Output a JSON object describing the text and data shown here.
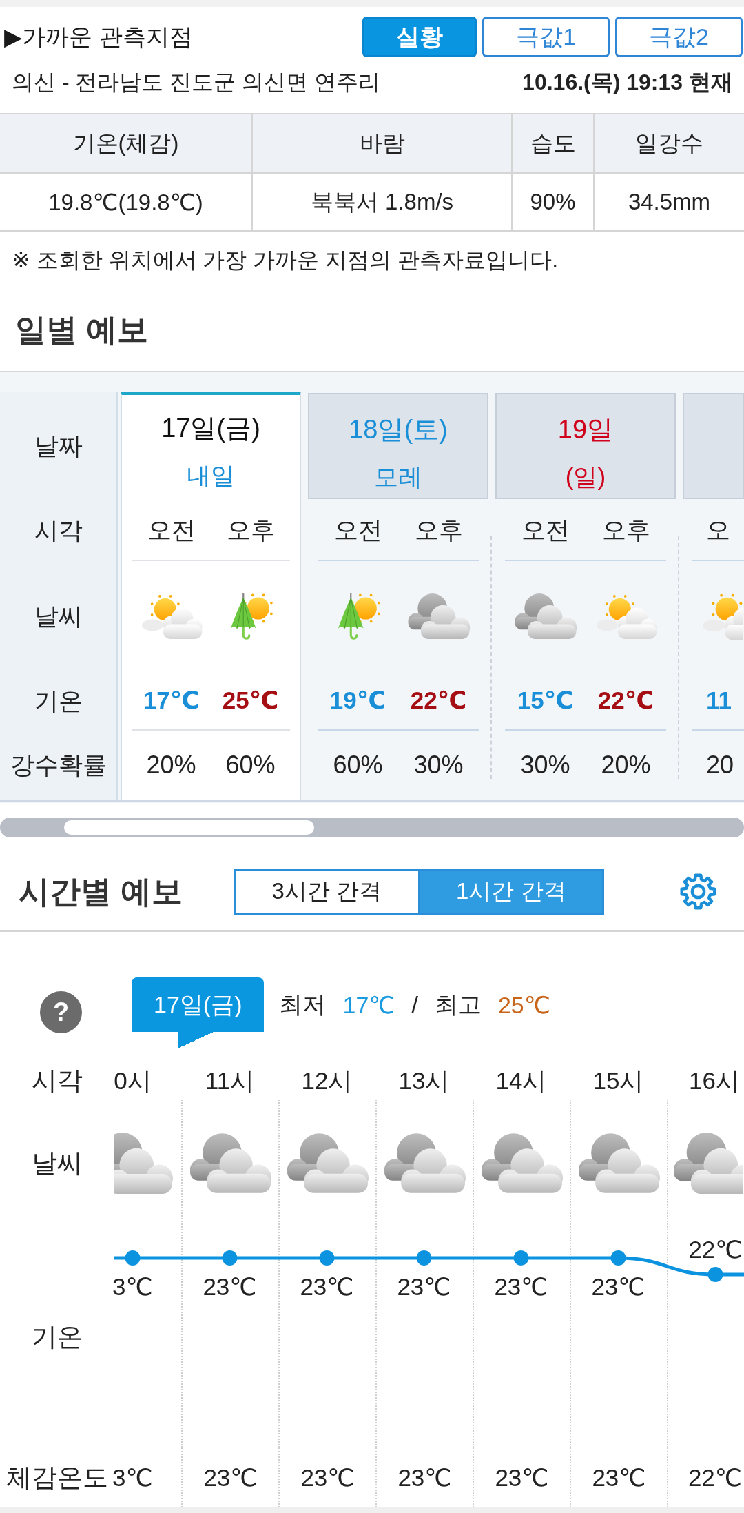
{
  "station": {
    "title": "▶가까운 관측지점",
    "modes": [
      {
        "label": "실황",
        "selected": true
      },
      {
        "label": "극값1",
        "selected": false
      },
      {
        "label": "극값2",
        "selected": false
      }
    ],
    "location": "의신 - 전라남도 진도군 의신면 연주리",
    "observed_at": "10.16.(목) 19:13 현재"
  },
  "observation_table": {
    "columns": [
      "기온(체감)",
      "바람",
      "습도",
      "일강수"
    ],
    "values": [
      "19.8℃(19.8℃)",
      "북북서 1.8m/s",
      "90%",
      "34.5mm"
    ]
  },
  "note": "※ 조회한 위치에서 가장 가까운 지점의 관측자료입니다.",
  "daily_forecast": {
    "title": "일별 예보",
    "row_labels": [
      "날짜",
      "시각",
      "날씨",
      "기온",
      "강수확률"
    ],
    "days": [
      {
        "date": "17일(금)",
        "color": "#111111",
        "note": {
          "text": "내일",
          "color": "#1a8fd8"
        },
        "selected": true,
        "periods": [
          {
            "time": "오전",
            "kind": "partly_cloudy",
            "temp": {
              "text": "17℃",
              "color": "#1a8fd8"
            },
            "pop": "20%"
          },
          {
            "time": "오후",
            "kind": "rain",
            "temp": {
              "text": "25℃",
              "color": "#a50f14"
            },
            "pop": "60%"
          }
        ]
      },
      {
        "date": "18일(토)",
        "color": "#1a8fd8",
        "note": {
          "text": "모레",
          "color": "#1a8fd8"
        },
        "selected": false,
        "periods": [
          {
            "time": "오전",
            "kind": "rain",
            "temp": {
              "text": "19℃",
              "color": "#1a8fd8"
            },
            "pop": "60%"
          },
          {
            "time": "오후",
            "kind": "cloudy",
            "temp": {
              "text": "22℃",
              "color": "#a50f14"
            },
            "pop": "30%"
          }
        ]
      },
      {
        "date": "19일",
        "color": "#d0021b",
        "note": {
          "text": "(일)",
          "color": "#d0021b"
        },
        "selected": false,
        "periods": [
          {
            "time": "오전",
            "kind": "cloudy",
            "temp": {
              "text": "15℃",
              "color": "#1a8fd8"
            },
            "pop": "30%"
          },
          {
            "time": "오후",
            "kind": "partly_cloudy",
            "temp": {
              "text": "22℃",
              "color": "#a50f14"
            },
            "pop": "20%"
          }
        ]
      },
      {
        "selected": false,
        "periods": [
          {
            "time": "오",
            "kind": "partly_cloudy",
            "temp": {
              "text": "11",
              "color": "#1a8fd8"
            },
            "pop": "20"
          }
        ]
      }
    ]
  },
  "hourly_forecast": {
    "title": "시간별 예보",
    "intervals": [
      {
        "label": "3시간 간격",
        "selected": false
      },
      {
        "label": "1시간 간격",
        "selected": true
      }
    ],
    "help": "?",
    "date": "17일(금)",
    "min_label": "최저",
    "min": "17℃",
    "separator": "/",
    "max_label": "최고",
    "max": "25℃",
    "row_labels": [
      "시각",
      "날씨",
      "기온",
      "체감온도"
    ],
    "hours": [
      {
        "kind": "cloudy",
        "feels": "3℃"
      },
      {
        "kind": "cloudy",
        "feels": "23℃"
      },
      {
        "kind": "cloudy",
        "feels": "23℃"
      },
      {
        "kind": "cloudy",
        "feels": "23℃"
      },
      {
        "kind": "cloudy",
        "feels": "23℃"
      },
      {
        "kind": "cloudy",
        "feels": "23℃"
      },
      {
        "kind": "cloudy",
        "feels": "22℃"
      }
    ],
    "cut_off_label": "3℃",
    "chart_data": {
      "type": "line",
      "categories": [
        "0시",
        "11시",
        "12시",
        "13시",
        "14시",
        "15시",
        "16시"
      ],
      "series": [
        {
          "color": "#0b93df",
          "marker": "circle",
          "values": [
            23,
            23,
            23,
            23,
            23,
            23,
            22
          ],
          "value_labels": [
            null,
            "23℃",
            "23℃",
            "23℃",
            "23℃",
            "23℃",
            "22℃"
          ]
        }
      ]
    }
  }
}
